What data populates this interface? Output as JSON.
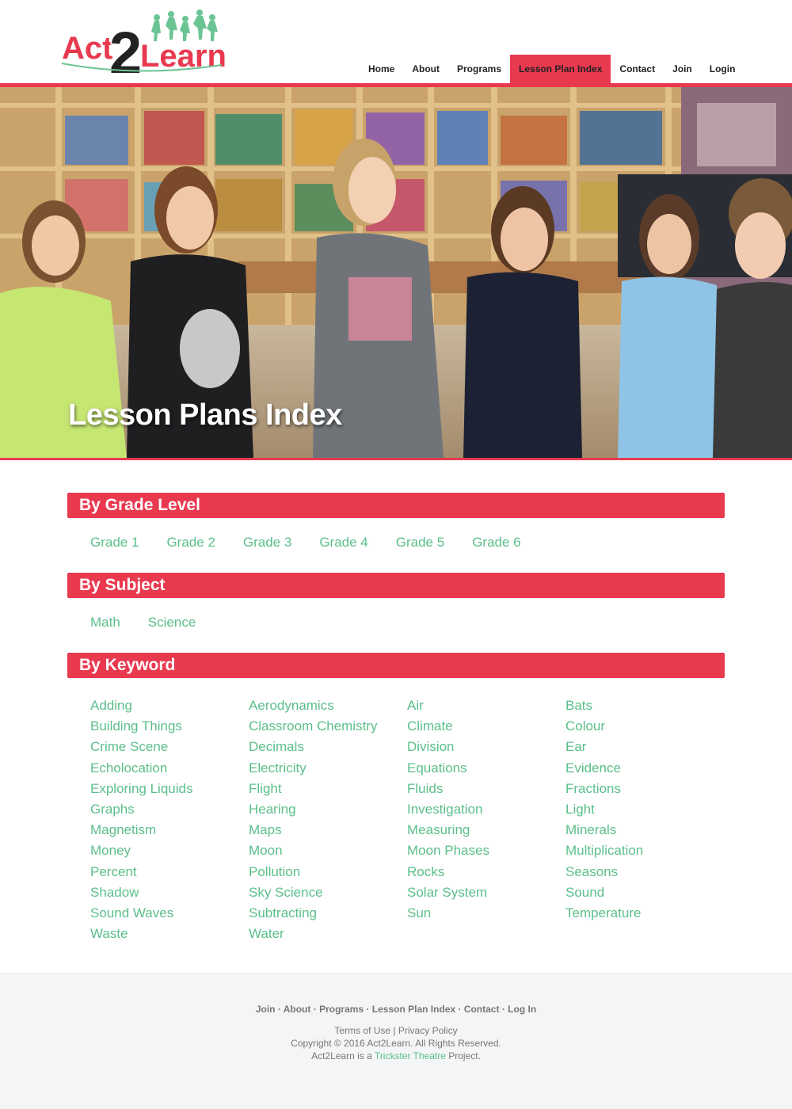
{
  "brand": {
    "logo_text_1": "Act",
    "logo_text_2": "2",
    "logo_text_3": "Learn"
  },
  "nav": [
    {
      "label": "Home",
      "active": false
    },
    {
      "label": "About",
      "active": false
    },
    {
      "label": "Programs",
      "active": false
    },
    {
      "label": "Lesson Plan Index",
      "active": true
    },
    {
      "label": "Contact",
      "active": false
    },
    {
      "label": "Join",
      "active": false
    },
    {
      "label": "Login",
      "active": false
    }
  ],
  "hero": {
    "title": "Lesson Plans Index"
  },
  "grade_section": {
    "heading": "By Grade Level",
    "links": [
      "Grade 1",
      "Grade 2",
      "Grade 3",
      "Grade 4",
      "Grade 5",
      "Grade 6"
    ]
  },
  "subject_section": {
    "heading": "By Subject",
    "links": [
      "Math",
      "Science"
    ]
  },
  "keyword_section": {
    "heading": "By Keyword",
    "columns": [
      [
        "Adding",
        "Building Things",
        "Crime Scene",
        "Echolocation",
        "Exploring Liquids",
        "Graphs",
        "Magnetism",
        "Money",
        "Percent",
        "Shadow",
        "Sound Waves",
        "Waste"
      ],
      [
        "Aerodynamics",
        "Classroom Chemistry",
        "Decimals",
        "Electricity",
        "Flight",
        "Hearing",
        "Maps",
        "Moon",
        "Pollution",
        "Sky Science",
        "Subtracting",
        "Water"
      ],
      [
        "Air",
        "Climate",
        "Division",
        "Equations",
        "Fluids",
        "Investigation",
        "Measuring",
        "Moon Phases",
        "Rocks",
        "Solar System",
        "Sun"
      ],
      [
        "Bats",
        "Colour",
        "Ear",
        "Evidence",
        "Fractions",
        "Light",
        "Minerals",
        "Multiplication",
        "Seasons",
        "Sound",
        "Temperature"
      ]
    ]
  },
  "footer": {
    "nav": [
      "Join",
      "About",
      "Programs",
      "Lesson Plan Index",
      "Contact",
      "Log In"
    ],
    "separator": " · ",
    "terms": "Terms of Use",
    "pipe": " | ",
    "privacy": "Privacy Policy",
    "copyright": "Copyright © 2016 Act2Learn. All Rights Reserved.",
    "project_prefix": "Act2Learn is a ",
    "project_link": "Trickster Theatre",
    "project_suffix": " Project."
  },
  "colors": {
    "accent": "#e8394f",
    "link_green": "#5bbf8a"
  }
}
